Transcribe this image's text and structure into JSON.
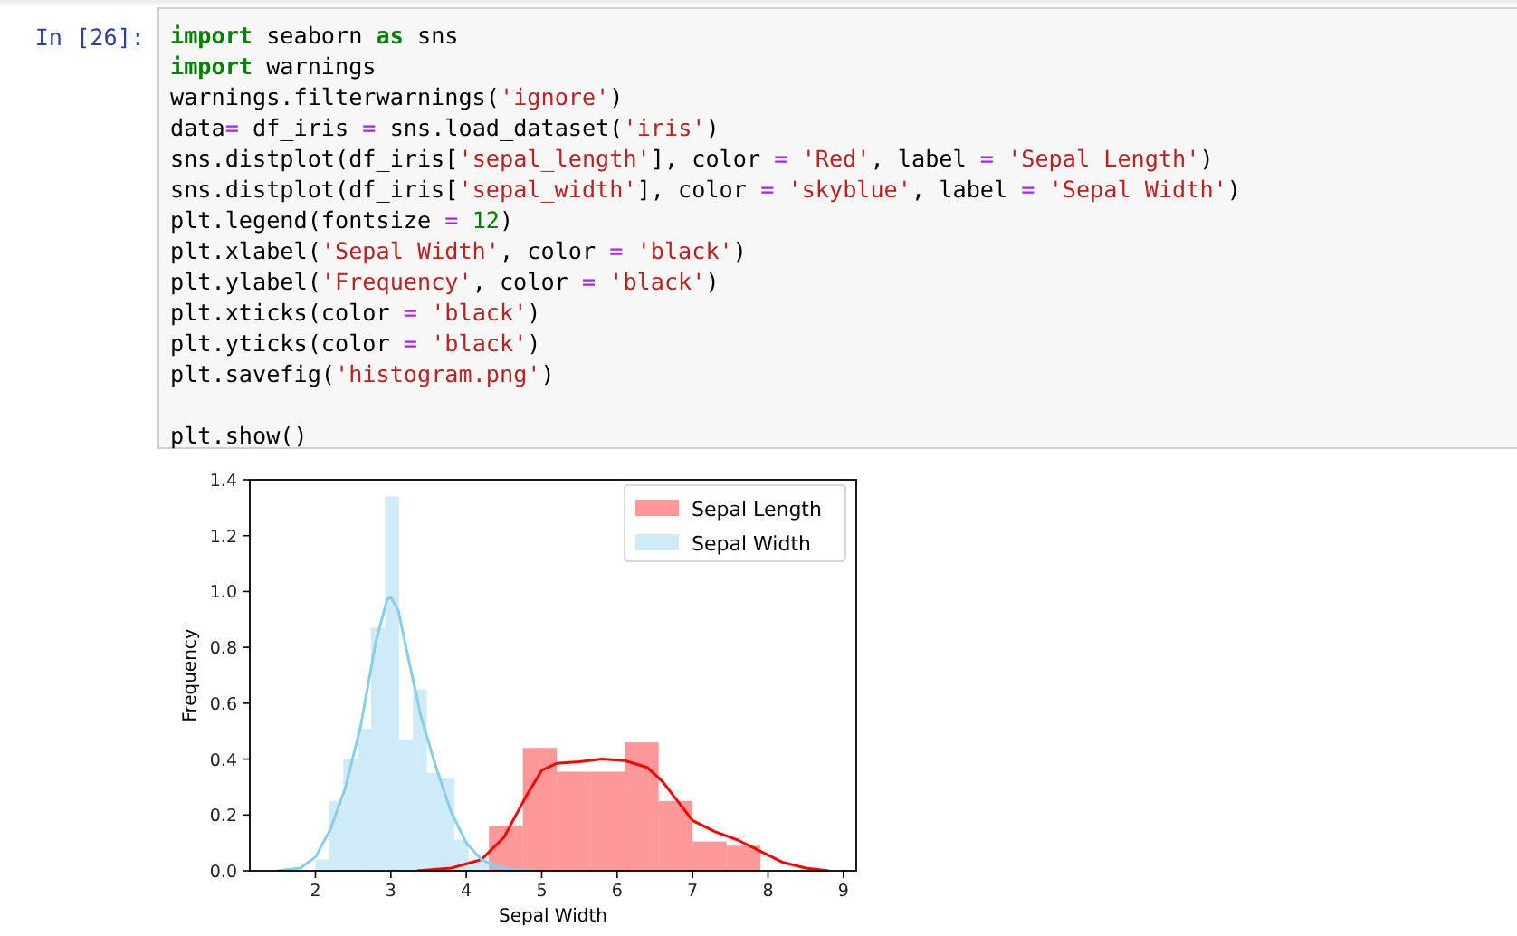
{
  "cell": {
    "prompt": "In [26]:",
    "lines": [
      {
        "tokens": [
          {
            "kind": "kw",
            "text": "import"
          },
          {
            "kind": "p",
            "text": " seaborn "
          },
          {
            "kind": "kw",
            "text": "as"
          },
          {
            "kind": "p",
            "text": " sns"
          }
        ]
      },
      {
        "tokens": [
          {
            "kind": "kw",
            "text": "import"
          },
          {
            "kind": "p",
            "text": " warnings"
          }
        ]
      },
      {
        "tokens": [
          {
            "kind": "p",
            "text": "warnings.filterwarnings("
          },
          {
            "kind": "str",
            "text": "'ignore'"
          },
          {
            "kind": "p",
            "text": ")"
          }
        ]
      },
      {
        "tokens": [
          {
            "kind": "p",
            "text": "data"
          },
          {
            "kind": "op",
            "text": "= "
          },
          {
            "kind": "p",
            "text": "df_iris"
          },
          {
            "kind": "op",
            "text": " = "
          },
          {
            "kind": "p",
            "text": "sns.load_dataset("
          },
          {
            "kind": "str",
            "text": "'iris'"
          },
          {
            "kind": "p",
            "text": ")"
          }
        ]
      },
      {
        "tokens": [
          {
            "kind": "p",
            "text": "sns.distplot(df_iris["
          },
          {
            "kind": "str",
            "text": "'sepal_length'"
          },
          {
            "kind": "p",
            "text": "], color"
          },
          {
            "kind": "op",
            "text": " = "
          },
          {
            "kind": "str",
            "text": "'Red'"
          },
          {
            "kind": "p",
            "text": ", label"
          },
          {
            "kind": "op",
            "text": " = "
          },
          {
            "kind": "str",
            "text": "'Sepal Length'"
          },
          {
            "kind": "p",
            "text": ")"
          }
        ]
      },
      {
        "tokens": [
          {
            "kind": "p",
            "text": "sns.distplot(df_iris["
          },
          {
            "kind": "str",
            "text": "'sepal_width'"
          },
          {
            "kind": "p",
            "text": "], color"
          },
          {
            "kind": "op",
            "text": " = "
          },
          {
            "kind": "str",
            "text": "'skyblue'"
          },
          {
            "kind": "p",
            "text": ", label"
          },
          {
            "kind": "op",
            "text": " = "
          },
          {
            "kind": "str",
            "text": "'Sepal Width'"
          },
          {
            "kind": "p",
            "text": ")"
          }
        ]
      },
      {
        "tokens": [
          {
            "kind": "p",
            "text": "plt.legend(fontsize"
          },
          {
            "kind": "op",
            "text": " = "
          },
          {
            "kind": "num",
            "text": "12"
          },
          {
            "kind": "p",
            "text": ")"
          }
        ]
      },
      {
        "tokens": [
          {
            "kind": "p",
            "text": "plt.xlabel("
          },
          {
            "kind": "str",
            "text": "'Sepal Width'"
          },
          {
            "kind": "p",
            "text": ", color"
          },
          {
            "kind": "op",
            "text": " = "
          },
          {
            "kind": "str",
            "text": "'black'"
          },
          {
            "kind": "p",
            "text": ")"
          }
        ]
      },
      {
        "tokens": [
          {
            "kind": "p",
            "text": "plt.ylabel("
          },
          {
            "kind": "str",
            "text": "'Frequency'"
          },
          {
            "kind": "p",
            "text": ", color"
          },
          {
            "kind": "op",
            "text": " = "
          },
          {
            "kind": "str",
            "text": "'black'"
          },
          {
            "kind": "p",
            "text": ")"
          }
        ]
      },
      {
        "tokens": [
          {
            "kind": "p",
            "text": "plt.xticks(color"
          },
          {
            "kind": "op",
            "text": " = "
          },
          {
            "kind": "str",
            "text": "'black'"
          },
          {
            "kind": "p",
            "text": ")"
          }
        ]
      },
      {
        "tokens": [
          {
            "kind": "p",
            "text": "plt.yticks(color"
          },
          {
            "kind": "op",
            "text": " = "
          },
          {
            "kind": "str",
            "text": "'black'"
          },
          {
            "kind": "p",
            "text": ")"
          }
        ]
      },
      {
        "tokens": [
          {
            "kind": "p",
            "text": "plt.savefig("
          },
          {
            "kind": "str",
            "text": "'histogram.png'"
          },
          {
            "kind": "p",
            "text": ")"
          }
        ]
      },
      {
        "gap_before": true,
        "tokens": [
          {
            "kind": "p",
            "text": "plt.show()"
          }
        ]
      }
    ]
  },
  "output": {
    "chart_data": {
      "type": "bar",
      "xlabel": "Sepal Width",
      "ylabel": "Frequency",
      "xlim": [
        1.13,
        9.17
      ],
      "ylim": [
        0,
        1.4
      ],
      "legend": true,
      "xticks": [
        2,
        3,
        4,
        5,
        6,
        7,
        8,
        9
      ],
      "yticks": [
        {
          "value": 0,
          "label": "0.0"
        },
        {
          "value": 0.2,
          "label": "0.2"
        },
        {
          "value": 0.4,
          "label": "0.4"
        },
        {
          "value": 0.6,
          "label": "0.6"
        },
        {
          "value": 0.8,
          "label": "0.8"
        },
        {
          "value": 1,
          "label": "1.0"
        },
        {
          "value": 1.2,
          "label": "1.2"
        },
        {
          "value": 1.4,
          "label": "1.4"
        }
      ],
      "series": [
        {
          "name": "Sepal Length",
          "color": "#ff0000",
          "x": [
            4.3,
            4.75,
            5.2,
            5.65,
            6.1,
            6.55,
            7.0,
            7.45
          ],
          "values": [
            0.16,
            0.44,
            0.355,
            0.355,
            0.46,
            0.25,
            0.105,
            0.09
          ]
        },
        {
          "color": "#ff0000",
          "type": "line",
          "x": [
            3.35,
            3.8,
            4.2,
            4.5,
            4.8,
            5.0,
            5.2,
            5.5,
            5.8,
            6.1,
            6.4,
            6.6,
            6.8,
            7.0,
            7.3,
            7.6,
            7.9,
            8.2,
            8.5,
            8.8
          ],
          "values": [
            0,
            0.01,
            0.04,
            0.12,
            0.27,
            0.36,
            0.385,
            0.39,
            0.4,
            0.395,
            0.37,
            0.32,
            0.25,
            0.18,
            0.14,
            0.11,
            0.07,
            0.03,
            0.01,
            0
          ]
        },
        {
          "name": "Sepal Width",
          "color": "#87ceeb",
          "x": [
            2.0,
            2.185,
            2.369,
            2.554,
            2.738,
            2.923,
            3.108,
            3.292,
            3.477,
            3.662,
            3.846,
            4.031,
            4.215
          ],
          "values": [
            0.04,
            0.25,
            0.4,
            0.51,
            0.87,
            1.34,
            0.47,
            0.65,
            0.35,
            0.33,
            0.11,
            0.04,
            0.03
          ]
        },
        {
          "color": "#87ceeb",
          "type": "line",
          "x": [
            1.5,
            1.8,
            2.0,
            2.2,
            2.4,
            2.6,
            2.8,
            2.95,
            3.0,
            3.1,
            3.2,
            3.4,
            3.6,
            3.8,
            4.0,
            4.2,
            4.4,
            4.6,
            4.9
          ],
          "values": [
            0,
            0.01,
            0.05,
            0.15,
            0.3,
            0.52,
            0.82,
            0.97,
            0.98,
            0.93,
            0.8,
            0.55,
            0.37,
            0.21,
            0.1,
            0.04,
            0.015,
            0.005,
            0
          ]
        }
      ]
    }
  }
}
